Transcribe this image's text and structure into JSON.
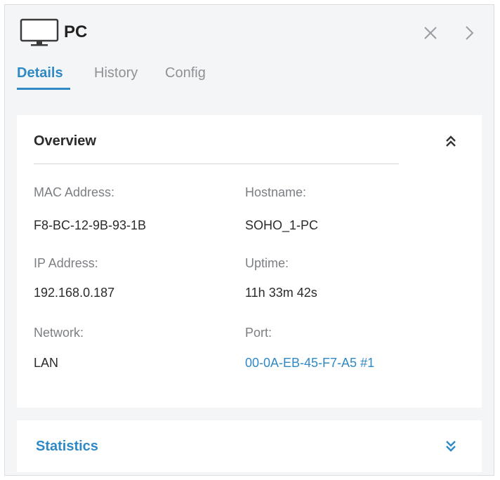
{
  "device": {
    "name": "PC",
    "icon": "monitor-icon"
  },
  "header": {
    "close_icon": "close-icon",
    "next_icon": "chevron-right-icon"
  },
  "tabs": [
    {
      "label": "Details",
      "active": true
    },
    {
      "label": "History",
      "active": false
    },
    {
      "label": "Config",
      "active": false
    }
  ],
  "overview": {
    "title": "Overview",
    "toggle_icon": "double-chevron-up-icon",
    "fields": {
      "mac": {
        "label": "MAC Address:",
        "value": "F8-BC-12-9B-93-1B"
      },
      "hostname": {
        "label": "Hostname:",
        "value": "SOHO_1-PC"
      },
      "ip": {
        "label": "IP Address:",
        "value": "192.168.0.187"
      },
      "uptime": {
        "label": "Uptime:",
        "value": "11h 33m 42s"
      },
      "network": {
        "label": "Network:",
        "value": "LAN"
      },
      "port": {
        "label": "Port:",
        "value": "00-0A-EB-45-F7-A5 #1"
      }
    }
  },
  "statistics": {
    "title": "Statistics",
    "toggle_icon": "double-chevron-down-icon"
  },
  "colors": {
    "accent": "#2f89c5",
    "text": "#2b2b2b",
    "muted": "#7b7e83",
    "panel_bg": "#f4f5f7",
    "card_bg": "#ffffff"
  }
}
